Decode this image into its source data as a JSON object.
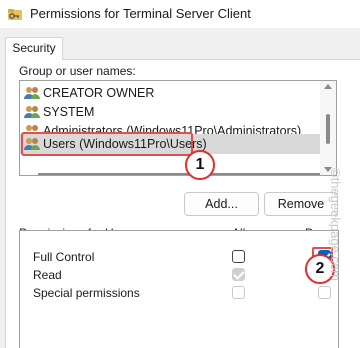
{
  "window": {
    "title": "Permissions for Terminal Server Client",
    "icon": "folder-key-icon"
  },
  "tabs": [
    {
      "label": "Security"
    }
  ],
  "groups_section": {
    "label": "Group or user names:",
    "items": [
      {
        "label": "CREATOR OWNER",
        "icon": "users-icon",
        "selected": false
      },
      {
        "label": "SYSTEM",
        "icon": "users-icon",
        "selected": false
      },
      {
        "label": "Administrators (Windows11Pro\\Administrators)",
        "icon": "users-icon",
        "selected": false
      },
      {
        "label": "Users (Windows11Pro\\Users)",
        "icon": "users-icon",
        "selected": true
      }
    ]
  },
  "buttons": {
    "add": "Add...",
    "remove": "Remove"
  },
  "permissions_section": {
    "header": "Permissions for Users",
    "allow_header": "Allow",
    "deny_header": "Deny",
    "rows": [
      {
        "name": "Full Control",
        "allow": "unchecked",
        "deny": "checked"
      },
      {
        "name": "Read",
        "allow": "disabled-checked",
        "deny": "checked"
      },
      {
        "name": "Special permissions",
        "allow": "disabled",
        "deny": "disabled"
      }
    ]
  },
  "annotations": [
    {
      "number": "1",
      "color": "#e03030"
    },
    {
      "number": "2",
      "color": "#e03030"
    }
  ],
  "watermark": {
    "symbol": "©",
    "text": "thegeekpage.com"
  },
  "colors": {
    "accent": "#0067c0",
    "annotation": "#e03030",
    "selection": "#d9d9d9"
  }
}
